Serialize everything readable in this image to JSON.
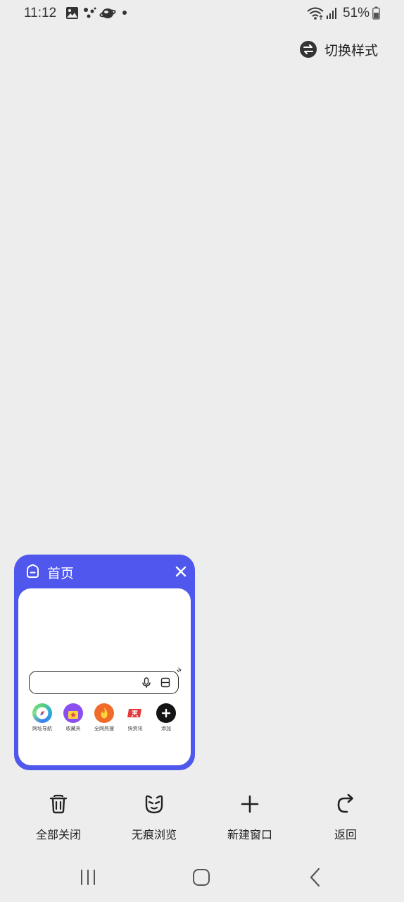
{
  "status_bar": {
    "time": "11:12",
    "battery": "51%",
    "notification_icons": [
      "image-icon",
      "assistant-dots-icon",
      "planet-icon",
      "dot-icon"
    ],
    "system_icons": [
      "wifi-icon",
      "signal-icon",
      "battery-icon"
    ]
  },
  "header": {
    "switch_style_label": "切换样式",
    "switch_style_icon": "swap-arrows-icon"
  },
  "tab_card": {
    "title": "首页",
    "icon": "home-icon",
    "close_icon": "close-icon",
    "accent_color": "#4f57ec",
    "preview": {
      "search_icons": [
        "mic-icon",
        "scan-icon"
      ],
      "shortcuts": [
        {
          "label": "网址导航",
          "icon": "compass-icon"
        },
        {
          "label": "收藏夹",
          "icon": "star-folder-icon"
        },
        {
          "label": "全网热搜",
          "icon": "flame-icon"
        },
        {
          "label": "快资讯",
          "icon": "news-icon"
        },
        {
          "label": "添加",
          "icon": "plus-icon"
        }
      ]
    }
  },
  "toolbar": {
    "close_all": "全部关闭",
    "incognito": "无痕浏览",
    "new_window": "新建窗口",
    "back": "返回"
  },
  "nav": {
    "items": [
      "recent-apps-icon",
      "home-button-icon",
      "back-arrow-icon"
    ]
  }
}
